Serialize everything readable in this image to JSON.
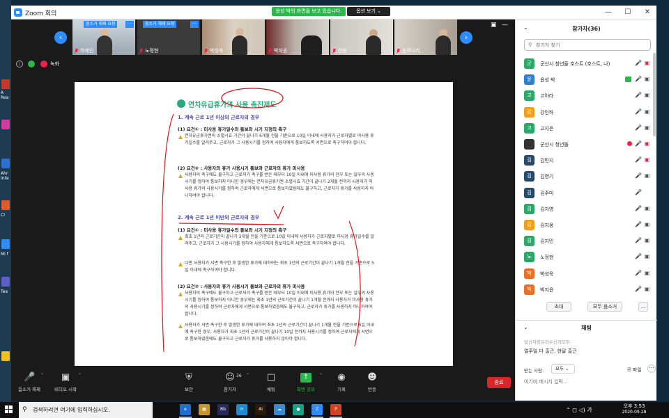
{
  "window": {
    "title": "Zoom 회의"
  },
  "share_banner": "윤성 박의 화면을 보고 있습니다.",
  "view_options": "옵션 보기 ⌄",
  "desktop_labels": [
    "A Rea",
    "Ahr Inte",
    "Cl",
    "Mi f",
    "Tea"
  ],
  "video_tiles": [
    {
      "name": "하예린",
      "request": "음소거 해제 요청",
      "more": "···"
    },
    {
      "name": "노정현",
      "request": "음소거 해제 요청",
      "more": "···"
    },
    {
      "name": "박성욱"
    },
    {
      "name": "박지윤"
    },
    {
      "name": "전용"
    },
    {
      "name": "송희나리"
    }
  ],
  "recording_label": "녹화",
  "document": {
    "title": "연차유급휴가의 사용 촉진제도",
    "section1": "1. 계속 근로 1년 이상의 근로자의 경우",
    "s1_req1": "(1) 요건① : 미사용 휴가일수의 통보와 시기 지정의 촉구",
    "s1_req1_text": "연차유급휴가권의 소멸시효 기간이 끝나기 6개월 전을 기준으로 10일 이내에 사용자가 근로자별로 미사용 휴가일수를 알려주고, 근로자가 그 사용시기를 정하여 사용자에게 통보하도록 서면으로 촉구하여야 합니다.",
    "s1_req2": "(2) 요건② : 사용자의 휴가 사용시기 통보와 근로자의 휴가 미사용",
    "s1_req2_text": "사용자의 촉구에도 불구하고 근로자가 촉구를 받은 때부터 10일 이내에 미사용 휴가의 전부 또는 일부의 사용시기를 정하여 통보하지 아니한 경우에는 연차유급휴가권 소멸시효 기간이 끝나기 2개월 전까지 사용자가 미사용 휴가의 사용시기를 정하여 근로자에게 서면으로 통보하였음에도 불구하고, 근로자가 휴가를 사용하지 아니하여야 합니다.",
    "section2": "2. 계속 근로 1년 미만의 근로자의 경우",
    "s2_req1": "(1) 요건① : 미사용 휴가일수의 통보와 시기 지정의 촉구",
    "s2_req1_text_a": "최초 1년의 근로기간이 끝나기 3개월 전을 기준으로 10일 이내에 사용자가 근로자별로 미사용 휴가일수를 알려주고, 근로자가 그 사용시기를 정하여 사용자에게 통보하도록 서면으로 촉구하여야 합니다.",
    "s2_req1_text_b": "다만 사용자가 서면 촉구한 후 발생한 휴가에 대하여는 최초 1년의 근로기간이 끝나기 1개월 전을 기준으로 5일 이내에 촉구하여야 합니다.",
    "s2_req2": "(2) 요건② : 사용자의 휴가 사용시기 통보와 근로자의 휴가 미사용",
    "s2_req2_text_a": "사용자의 촉구에도 불구하고 근로자가 촉구를 받은 때부터 10일 이내에 미사용 휴가의 전부 또는 일부의 사용시기를 정하여 통보하지 아니한 경우에는 최초 1년의 근로기간이 끝나기 1개월 전까지 사용자가 미사용 휴가의 사용시기를 정하여 근로자에게 서면으로 통보하였음에도 불구하고, 근로자가 휴가를 사용하지 아니하여야 합니다.",
    "s2_req2_text_b": "사용자가 서면 촉구한 후 발생한 휴가에 대하여 최초 1년의 근로기간이 끝나기 1개월 전을 기준으로 5일 이내에 촉구한 경우, 사용자가 최초 1년의 근로기간이 끝나기 10일 전까지 사용시기를 정하여 근로자에게 서면으로 통보하였음에도 불구하고 근로자가 휴가를 사용하지 않아야 합니다."
  },
  "toolbar": {
    "unmute": "음소거 해제",
    "start_video": "비디오 시작",
    "security": "보안",
    "participants": "참가자",
    "participants_count": "36",
    "chat": "채팅",
    "share_screen": "화면 공유",
    "record": "기록",
    "reactions": "반응",
    "end": "종료"
  },
  "participants_panel": {
    "title": "참가자(36)",
    "search_placeholder": "참가자 찾기",
    "participants": [
      {
        "initial": "군",
        "name": "군산시 청년들 호스트 (호스트, 나)",
        "color": "#2ea86a"
      },
      {
        "initial": "윤",
        "name": "윤성 박",
        "color": "#2d7fd0"
      },
      {
        "initial": "고",
        "name": "고아라",
        "color": "#2ea86a"
      },
      {
        "initial": "강",
        "name": "강인하",
        "color": "#f0a020"
      },
      {
        "initial": "고",
        "name": "고지은",
        "color": "#2ea86a"
      },
      {
        "initial": "",
        "name": "군산시 청년들",
        "color": "#333333"
      },
      {
        "initial": "김",
        "name": "김민지",
        "color": "#2a4a6a"
      },
      {
        "initial": "김",
        "name": "김영기",
        "color": "#2a4a6a"
      },
      {
        "initial": "김",
        "name": "김주미",
        "color": "#2a4a6a"
      },
      {
        "initial": "김",
        "name": "김지영",
        "color": "#2ea86a"
      },
      {
        "initial": "김",
        "name": "김지웅",
        "color": "#f0a020"
      },
      {
        "initial": "김",
        "name": "김지민",
        "color": "#2ea86a"
      },
      {
        "initial": "노",
        "name": "노정현",
        "color": "#2ea86a"
      },
      {
        "initial": "박",
        "name": "박성욱",
        "color": "#e8702a"
      },
      {
        "initial": "박",
        "name": "박지윤",
        "color": "#e8702a"
      }
    ],
    "invite": "초대",
    "mute_all": "모두 음소거",
    "more": "..."
  },
  "chat": {
    "title": "채팅",
    "meta": "발신자정유라수신자모두:",
    "message": "얼주일 다 출근, 한달 출근",
    "to_label": "받는 사람:",
    "to_value": "모두 ⌄",
    "file": "파일",
    "more": "···",
    "input_placeholder": "여기에 메시지 입력..."
  },
  "taskbar": {
    "search_placeholder": "검색하려면 여기에 입력하십시오.",
    "apps": [
      "e",
      "▦",
      "Bb",
      "⟳",
      "Ai",
      "☁",
      "●",
      "Z",
      "P"
    ],
    "tray": "⌃ ◻ ◁) 가",
    "time": "오후 3:53",
    "date": "2020-09-28"
  },
  "colors": {
    "zoom_blue": "#2d8cff",
    "banner_green": "#2db84c",
    "end_red": "#d9262b",
    "doc_title_green": "#2aa87a",
    "ink_red": "#e0161a"
  }
}
